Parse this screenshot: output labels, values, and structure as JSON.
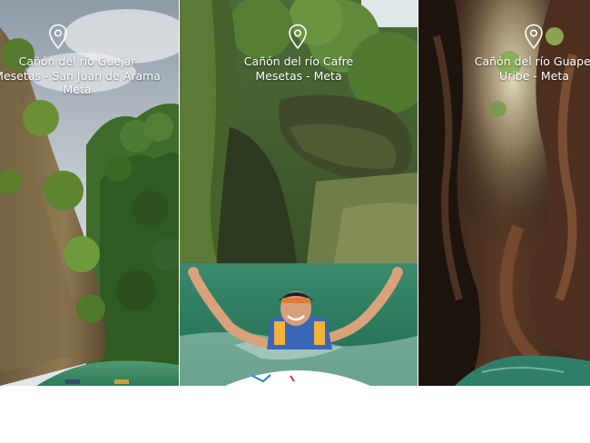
{
  "panels": [
    {
      "location_icon": "map-pin-icon",
      "line1": "Cañón del río Guejar",
      "line2": "Mesetas - San Juan de Arama",
      "line3": "Meta"
    },
    {
      "location_icon": "map-pin-icon",
      "line1": "Cañón del río Cafre",
      "line2": "Mesetas - Meta",
      "line3": ""
    },
    {
      "location_icon": "map-pin-icon",
      "line1": "Cañón del río Guapel",
      "line2": "Uribe - Meta",
      "line3": ""
    }
  ]
}
